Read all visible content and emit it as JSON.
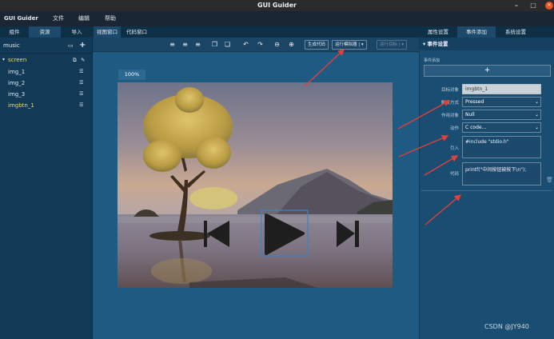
{
  "window": {
    "title": "GUI Guider"
  },
  "menu": {
    "app_label": "GUI Guider",
    "items": [
      "文件",
      "编辑",
      "帮助"
    ]
  },
  "left_tabs": [
    "组件",
    "资源",
    "导入",
    "视图窗口",
    "代码窗口"
  ],
  "right_tabs": [
    "属性设置",
    "事件添加",
    "系统设置"
  ],
  "toolbar": {
    "generate_code": "生成代码",
    "run_simulator": "运行模拟器",
    "run_target": "运行目标"
  },
  "project": {
    "name": "music",
    "screen": "screen",
    "widgets": [
      "img_1",
      "img_2",
      "img_3",
      "imgbtn_1"
    ]
  },
  "canvas": {
    "zoom": "100%"
  },
  "event_panel": {
    "section_title": "事件设置",
    "add_label": "事件添加",
    "add_btn": "+",
    "target_label": "目标对象",
    "target_value": "imgbtn_1",
    "trigger_label": "触发方式",
    "trigger_value": "Pressed",
    "scope_label": "作用对象",
    "scope_value": "Null",
    "action_label": "动作",
    "action_value": "C code...",
    "include_label": "引入",
    "include_value": "#include \"stdio.h\"",
    "code_label": "代码",
    "code_value": "printf(\"中间按钮被按下\\n\");"
  },
  "watermark": "CSDN @JY940"
}
